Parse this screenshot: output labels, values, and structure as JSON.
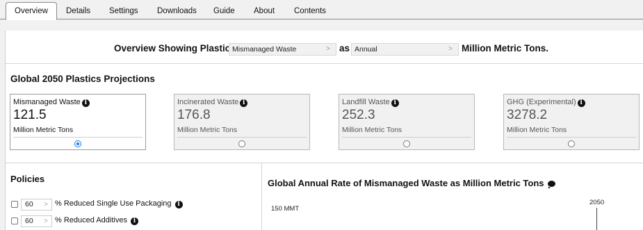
{
  "tabs": [
    {
      "label": "Overview",
      "active": true
    },
    {
      "label": "Details",
      "active": false
    },
    {
      "label": "Settings",
      "active": false
    },
    {
      "label": "Downloads",
      "active": false
    },
    {
      "label": "Guide",
      "active": false
    },
    {
      "label": "About",
      "active": false
    },
    {
      "label": "Contents",
      "active": false
    }
  ],
  "controls": {
    "prefix": "Overview Showing Plastic",
    "metric_select": "Mismanaged Waste",
    "as_label": "as",
    "period_select": "Annual",
    "suffix": "Million Metric Tons."
  },
  "projections": {
    "title": "Global 2050 Plastics Projections",
    "cards": [
      {
        "label": "Mismanaged Waste",
        "value": "121.5",
        "unit": "Million Metric Tons",
        "selected": true
      },
      {
        "label": "Incinerated Waste",
        "value": "176.8",
        "unit": "Million Metric Tons",
        "selected": false
      },
      {
        "label": "Landfill Waste",
        "value": "252.3",
        "unit": "Million Metric Tons",
        "selected": false
      },
      {
        "label": "GHG (Experimental)",
        "value": "3278.2",
        "unit": "Million Metric Tons",
        "selected": false
      }
    ]
  },
  "policies": {
    "title": "Policies",
    "items": [
      {
        "value": "60",
        "label": "% Reduced Single Use Packaging"
      },
      {
        "value": "60",
        "label": "% Reduced Additives"
      }
    ]
  },
  "chart": {
    "title": "Global Annual Rate of Mismanaged Waste as Million Metric Tons",
    "y_tick": "150 MMT",
    "year_marker": "2050"
  },
  "icons": {
    "info": "info-icon",
    "chevron": "chevron-right-icon",
    "chat": "chat-bubble-icon"
  },
  "colors": {
    "radio_selected": "#1a73e8"
  }
}
